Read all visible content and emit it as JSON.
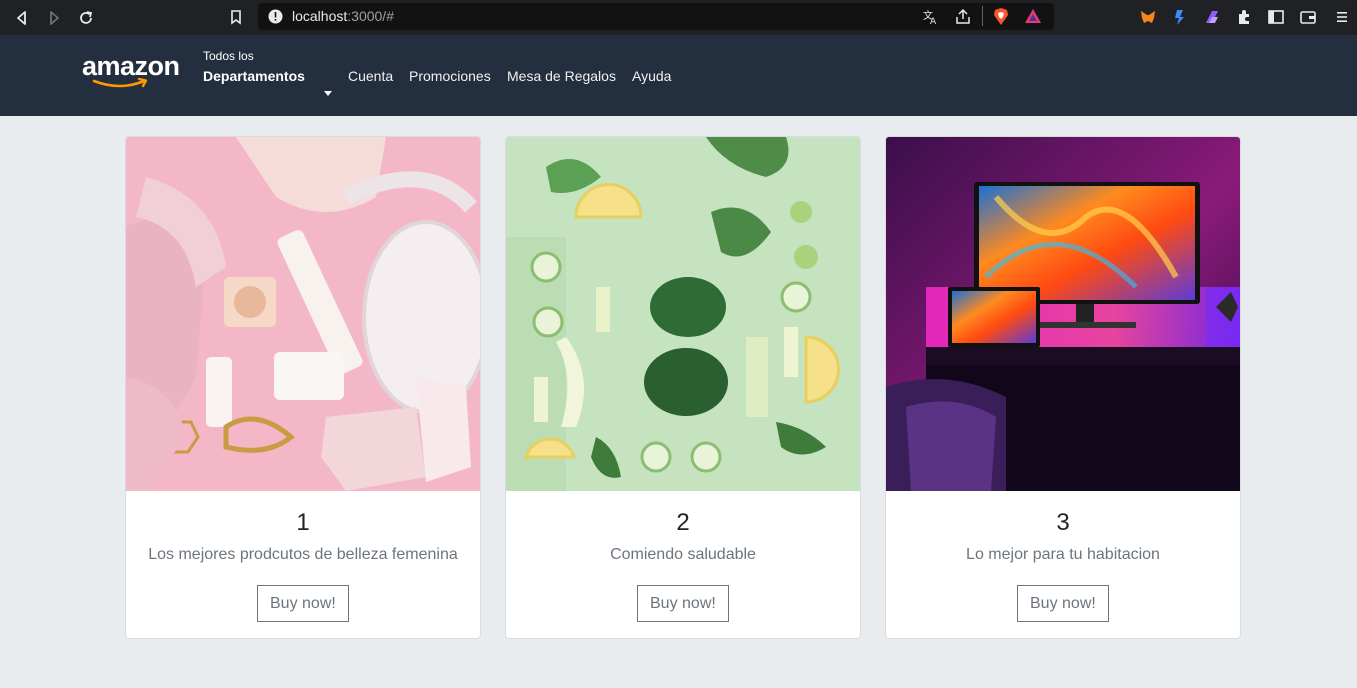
{
  "browser": {
    "url_host": "localhost",
    "url_rest": ":3000/#"
  },
  "navbar": {
    "logo_text": "amazon",
    "dept_small": "Todos los",
    "dept_big": "Departamentos",
    "links": [
      "Cuenta",
      "Promociones",
      "Mesa de Regalos",
      "Ayuda"
    ]
  },
  "cards": [
    {
      "number": "1",
      "description": "Los mejores prodcutos de belleza femenina",
      "button": "Buy now!"
    },
    {
      "number": "2",
      "description": "Comiendo saludable",
      "button": "Buy now!"
    },
    {
      "number": "3",
      "description": "Lo mejor para tu habitacion",
      "button": "Buy now!"
    }
  ],
  "colors": {
    "navbar_bg": "#232f3e",
    "page_bg": "#e9ecef",
    "button_border": "#6c757d"
  }
}
